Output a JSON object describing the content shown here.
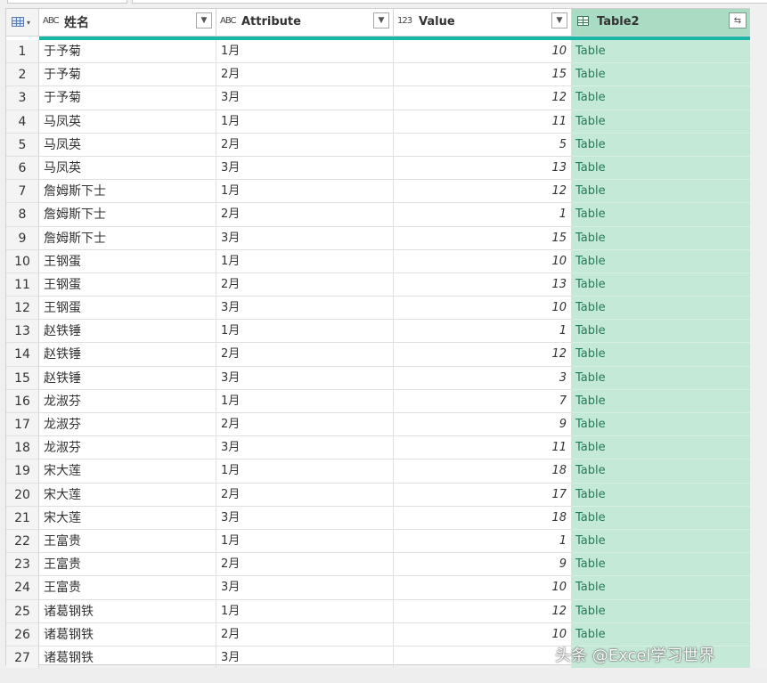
{
  "columns": [
    {
      "type_icon": "ABC",
      "label": "姓名"
    },
    {
      "type_icon": "ABC",
      "label": "Attribute"
    },
    {
      "type_icon": "123",
      "label": "Value"
    },
    {
      "type_icon": "table",
      "label": "Table2"
    }
  ],
  "rows": [
    {
      "n": "1",
      "name": "于予菊",
      "attr": "1月",
      "val": "10",
      "tbl": "Table"
    },
    {
      "n": "2",
      "name": "于予菊",
      "attr": "2月",
      "val": "15",
      "tbl": "Table"
    },
    {
      "n": "3",
      "name": "于予菊",
      "attr": "3月",
      "val": "12",
      "tbl": "Table"
    },
    {
      "n": "4",
      "name": "马凤英",
      "attr": "1月",
      "val": "11",
      "tbl": "Table"
    },
    {
      "n": "5",
      "name": "马凤英",
      "attr": "2月",
      "val": "5",
      "tbl": "Table"
    },
    {
      "n": "6",
      "name": "马凤英",
      "attr": "3月",
      "val": "13",
      "tbl": "Table"
    },
    {
      "n": "7",
      "name": "詹姆斯下士",
      "attr": "1月",
      "val": "12",
      "tbl": "Table"
    },
    {
      "n": "8",
      "name": "詹姆斯下士",
      "attr": "2月",
      "val": "1",
      "tbl": "Table"
    },
    {
      "n": "9",
      "name": "詹姆斯下士",
      "attr": "3月",
      "val": "15",
      "tbl": "Table"
    },
    {
      "n": "10",
      "name": "王钢蛋",
      "attr": "1月",
      "val": "10",
      "tbl": "Table"
    },
    {
      "n": "11",
      "name": "王钢蛋",
      "attr": "2月",
      "val": "13",
      "tbl": "Table"
    },
    {
      "n": "12",
      "name": "王钢蛋",
      "attr": "3月",
      "val": "10",
      "tbl": "Table"
    },
    {
      "n": "13",
      "name": "赵铁锤",
      "attr": "1月",
      "val": "1",
      "tbl": "Table"
    },
    {
      "n": "14",
      "name": "赵铁锤",
      "attr": "2月",
      "val": "12",
      "tbl": "Table"
    },
    {
      "n": "15",
      "name": "赵铁锤",
      "attr": "3月",
      "val": "3",
      "tbl": "Table"
    },
    {
      "n": "16",
      "name": "龙淑芬",
      "attr": "1月",
      "val": "7",
      "tbl": "Table"
    },
    {
      "n": "17",
      "name": "龙淑芬",
      "attr": "2月",
      "val": "9",
      "tbl": "Table"
    },
    {
      "n": "18",
      "name": "龙淑芬",
      "attr": "3月",
      "val": "11",
      "tbl": "Table"
    },
    {
      "n": "19",
      "name": "宋大莲",
      "attr": "1月",
      "val": "18",
      "tbl": "Table"
    },
    {
      "n": "20",
      "name": "宋大莲",
      "attr": "2月",
      "val": "17",
      "tbl": "Table"
    },
    {
      "n": "21",
      "name": "宋大莲",
      "attr": "3月",
      "val": "18",
      "tbl": "Table"
    },
    {
      "n": "22",
      "name": "王富贵",
      "attr": "1月",
      "val": "1",
      "tbl": "Table"
    },
    {
      "n": "23",
      "name": "王富贵",
      "attr": "2月",
      "val": "9",
      "tbl": "Table"
    },
    {
      "n": "24",
      "name": "王富贵",
      "attr": "3月",
      "val": "10",
      "tbl": "Table"
    },
    {
      "n": "25",
      "name": "诸葛钢铁",
      "attr": "1月",
      "val": "12",
      "tbl": "Table"
    },
    {
      "n": "26",
      "name": "诸葛钢铁",
      "attr": "2月",
      "val": "10",
      "tbl": "Table"
    },
    {
      "n": "27",
      "name": "诸葛钢铁",
      "attr": "3月",
      "val": "",
      "tbl": ""
    }
  ],
  "watermark": "头条 @Excel学习世界",
  "colors": {
    "accent": "#19b7a8",
    "table_col_bg": "#c4e9d6",
    "table_header_bg": "#a9dcc3",
    "table_text": "#1f7d58"
  }
}
